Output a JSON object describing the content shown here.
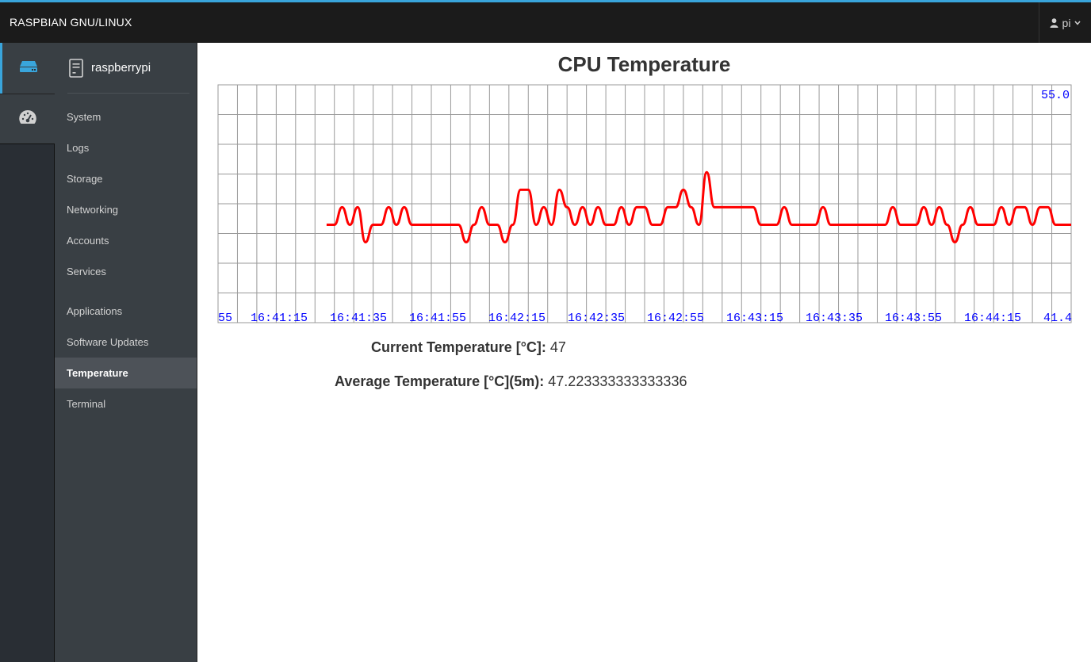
{
  "topbar": {
    "brand": "RASPBIAN GNU/LINUX",
    "user": "pi",
    "user_icon": "user-icon",
    "caret_icon": "chevron-down-icon"
  },
  "rail": {
    "items": [
      {
        "name": "hosts",
        "icon": "server-icon"
      },
      {
        "name": "dashboard",
        "icon": "dashboard-gauge-icon"
      }
    ]
  },
  "sidebar": {
    "host": "raspberrypi",
    "host_icon": "document-server-icon",
    "items": [
      {
        "label": "System"
      },
      {
        "label": "Logs"
      },
      {
        "label": "Storage"
      },
      {
        "label": "Networking"
      },
      {
        "label": "Accounts"
      },
      {
        "label": "Services"
      },
      {
        "label": "Applications"
      },
      {
        "label": "Software Updates"
      },
      {
        "label": "Temperature",
        "active": true
      },
      {
        "label": "Terminal"
      }
    ]
  },
  "main": {
    "title": "CPU Temperature",
    "current_label": "Current Temperature [°C]:",
    "current_value": "47",
    "average_label": "Average Temperature [°C](5m):",
    "average_value": "47.223333333333336"
  },
  "chart_data": {
    "type": "line",
    "title": "CPU Temperature",
    "xlabel": "",
    "ylabel": "",
    "y_max_label": "55.0",
    "y_min_label": "41.4",
    "ylim": [
      41.4,
      55.0
    ],
    "x_range_seconds": [
      0,
      220
    ],
    "x_tick_labels": [
      "55",
      "16:41:15",
      "16:41:35",
      "16:41:55",
      "16:42:15",
      "16:42:35",
      "16:42:55",
      "16:43:15",
      "16:43:35",
      "16:43:55",
      "16:44:15",
      "41.4"
    ],
    "grid": true,
    "series": [
      {
        "name": "CPU temperature",
        "color": "#ff0000",
        "start_seconds": 28,
        "step_seconds": 2,
        "values": [
          47,
          47,
          48,
          47,
          48,
          46,
          47,
          47,
          48,
          47,
          48,
          47,
          47,
          47,
          47,
          47,
          47,
          47,
          46,
          47,
          48,
          47,
          47,
          46,
          47,
          49,
          49,
          47,
          48,
          47,
          49,
          48,
          47,
          48,
          47,
          48,
          47,
          47,
          48,
          47,
          48,
          48,
          47,
          47,
          48,
          48,
          49,
          48,
          47,
          50,
          48,
          48,
          48,
          48,
          48,
          48,
          47,
          47,
          47,
          48,
          47,
          47,
          47,
          47,
          48,
          47,
          47,
          47,
          47,
          47,
          47,
          47,
          47,
          48,
          47,
          47,
          47,
          48,
          47,
          48,
          47,
          46,
          47,
          48,
          47,
          47,
          47,
          48,
          47,
          48,
          48,
          47,
          48,
          48,
          47
        ]
      }
    ],
    "series_note": "sampled approximately; trace ends at right edge"
  }
}
